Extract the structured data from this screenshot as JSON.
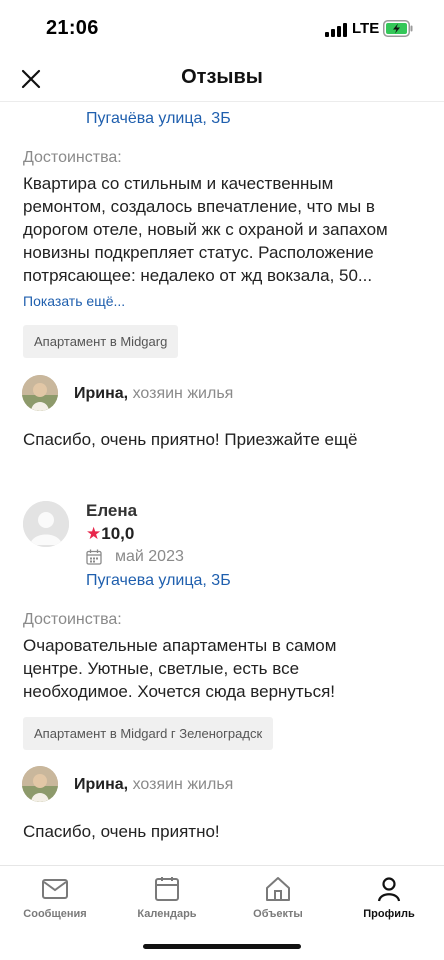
{
  "status_bar": {
    "time": "21:06",
    "network": "LTE"
  },
  "header": {
    "title": "Отзывы"
  },
  "review1": {
    "address": "Пугачёва улица, 3Б",
    "pros_label": "Достоинства:",
    "pros_lines": [
      "Квартира со стильным и качественным",
      "ремонтом, создалось впечатление, что мы в",
      "дорогом отеле, новый жк с охраной и запахом",
      "новизны подкрепляет статус. Расположение",
      "потрясающее: недалеко от жд вокзала, 50..."
    ],
    "show_more": "Показать ещё...",
    "tag": "Апартамент в Midgarg",
    "reply": {
      "owner_name": "Ирина,",
      "owner_role": "хозяин жилья",
      "text": "Спасибо, очень приятно! Приезжайте ещё"
    }
  },
  "review2": {
    "guest_name": "Елена",
    "rating": "10,0",
    "date": "май 2023",
    "address": "Пугачева улица, 3Б",
    "pros_label": "Достоинства:",
    "pros_lines": [
      "Очаровательные апартаменты в самом",
      "центре. Уютные, светлые, есть все",
      "необходимое. Хочется сюда вернуться!"
    ],
    "tag": "Апартамент в Midgard г Зеленоградск",
    "reply": {
      "owner_name": "Ирина,",
      "owner_role": "хозяин жилья",
      "text": "Спасибо, очень приятно!"
    }
  },
  "tabbar": {
    "items": [
      {
        "label": "Сообщения",
        "icon": "mail-icon"
      },
      {
        "label": "Календарь",
        "icon": "calendar-icon"
      },
      {
        "label": "Объекты",
        "icon": "home-icon"
      },
      {
        "label": "Профиль",
        "icon": "profile-icon",
        "active": true
      }
    ]
  },
  "colors": {
    "link": "#1f5fae",
    "star": "#e8264b",
    "muted": "#8a8a8a"
  }
}
